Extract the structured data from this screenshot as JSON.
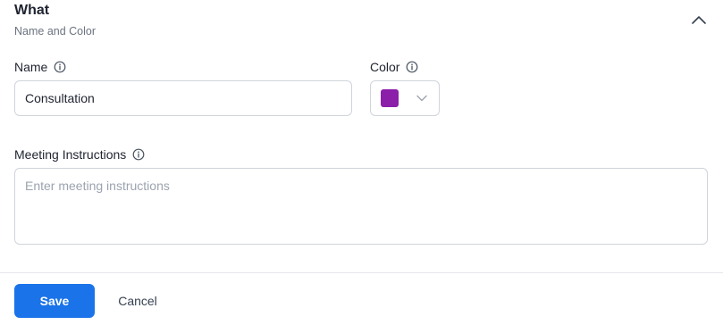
{
  "section": {
    "title": "What",
    "subtitle": "Name and Color",
    "collapse_icon": "chevron-up-icon"
  },
  "name_field": {
    "label": "Name",
    "value": "Consultation",
    "info_icon": "info-icon"
  },
  "color_field": {
    "label": "Color",
    "selected_color": "#8b1fa9",
    "info_icon": "info-icon",
    "dropdown_icon": "chevron-down-icon"
  },
  "instructions_field": {
    "label": "Meeting Instructions",
    "placeholder": "Enter meeting instructions",
    "value": "",
    "info_icon": "info-icon"
  },
  "footer": {
    "save_label": "Save",
    "cancel_label": "Cancel"
  },
  "colors": {
    "primary": "#1a73e8",
    "border": "#d0d4db",
    "text": "#1f2330",
    "muted": "#6b7280"
  }
}
